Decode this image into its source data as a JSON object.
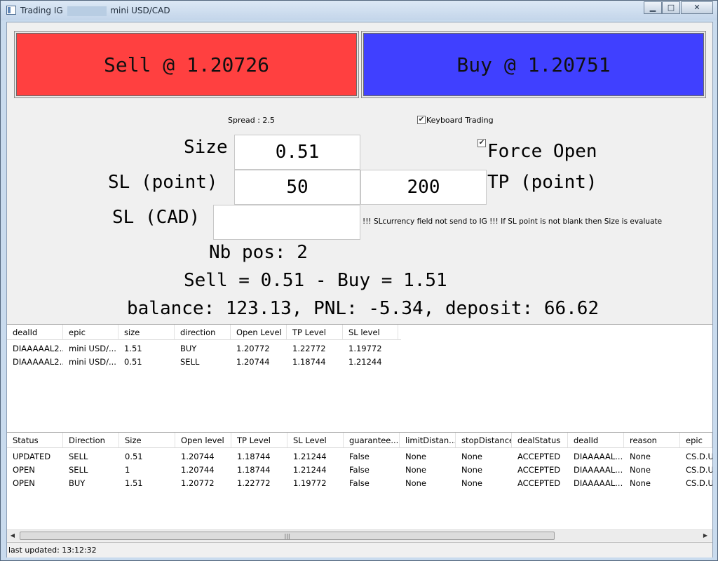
{
  "window": {
    "title_prefix": "Trading IG",
    "title_suffix": "mini USD/CAD",
    "minimize": "▁",
    "maximize": "□",
    "close": "✕"
  },
  "buttons": {
    "sell_label": "Sell @ 1.20726",
    "buy_label": "Buy @ 1.20751",
    "sell_color": "#ff4040",
    "buy_color": "#4040ff"
  },
  "spread": "Spread : 2.5",
  "keyboard_trading": {
    "label": "Keyboard Trading",
    "checked": true
  },
  "force_open": {
    "label": "Force Open",
    "checked": true
  },
  "form": {
    "size_label": "Size",
    "size_value": "0.51",
    "sl_point_label": "SL (point)",
    "sl_point_value": "50",
    "tp_point_value": "200",
    "tp_point_label": "TP (point)",
    "sl_cad_label": "SL (CAD)",
    "sl_cad_value": "",
    "sl_note": "!!! SLcurrency field not send to IG !!! If SL point is not blank then Size is evaluate"
  },
  "summary": {
    "nb_pos": "Nb pos: 2",
    "sell_buy": "Sell = 0.51 - Buy = 1.51",
    "balance_line": "balance: 123.13, PNL: -5.34, deposit: 66.62"
  },
  "positions_table": {
    "headers": [
      "dealId",
      "epic",
      "size",
      "direction",
      "Open Level",
      "TP Level",
      "SL level"
    ],
    "rows": [
      [
        "DIAAAAAL2...",
        "mini USD/...",
        "1.51",
        "BUY",
        "1.20772",
        "1.22772",
        "1.19772"
      ],
      [
        "DIAAAAAL2...",
        "mini USD/...",
        "0.51",
        "SELL",
        "1.20744",
        "1.18744",
        "1.21244"
      ]
    ]
  },
  "orders_table": {
    "headers": [
      "Status",
      "Direction",
      "Size",
      "Open level",
      "TP Level",
      "SL Level",
      "guarantee...",
      "limitDistan...",
      "stopDistance",
      "dealStatus",
      "dealId",
      "reason",
      "epic"
    ],
    "rows": [
      [
        "UPDATED",
        "SELL",
        "0.51",
        "1.20744",
        "1.18744",
        "1.21244",
        "False",
        "None",
        "None",
        "ACCEPTED",
        "DIAAAAAL...",
        "None",
        "CS.D.U!"
      ],
      [
        "OPEN",
        "SELL",
        "1",
        "1.20744",
        "1.18744",
        "1.21244",
        "False",
        "None",
        "None",
        "ACCEPTED",
        "DIAAAAAL...",
        "None",
        "CS.D.U!"
      ],
      [
        "OPEN",
        "BUY",
        "1.51",
        "1.20772",
        "1.22772",
        "1.19772",
        "False",
        "None",
        "None",
        "ACCEPTED",
        "DIAAAAAL...",
        "None",
        "CS.D.U!"
      ]
    ]
  },
  "scrollbar": {
    "left_arrow": "◀",
    "right_arrow": "▶",
    "grip": "|||"
  },
  "status": "last updated: 13:12:32"
}
